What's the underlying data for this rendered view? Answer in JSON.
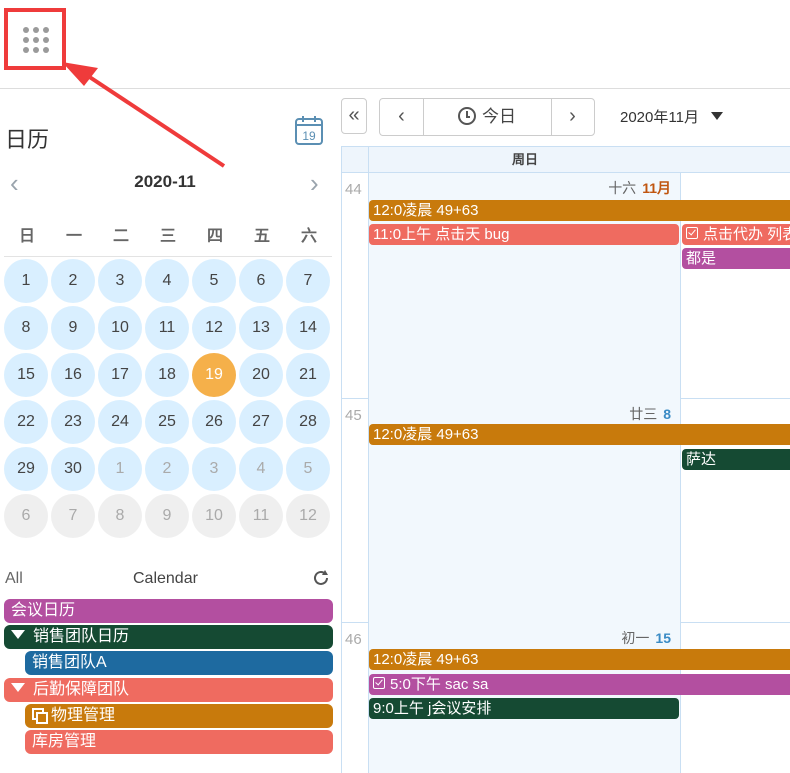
{
  "app": {
    "title": "日历"
  },
  "mini_calendar": {
    "month_label": "2020-11",
    "weekdays": [
      "日",
      "一",
      "二",
      "三",
      "四",
      "五",
      "六"
    ],
    "weeks": [
      [
        "1",
        "2",
        "3",
        "4",
        "5",
        "6",
        "7"
      ],
      [
        "8",
        "9",
        "10",
        "11",
        "12",
        "13",
        "14"
      ],
      [
        "15",
        "16",
        "17",
        "18",
        "19",
        "20",
        "21"
      ],
      [
        "22",
        "23",
        "24",
        "25",
        "26",
        "27",
        "28"
      ],
      [
        "29",
        "30",
        "1",
        "2",
        "3",
        "4",
        "5"
      ],
      [
        "6",
        "7",
        "8",
        "9",
        "10",
        "11",
        "12"
      ]
    ],
    "today": "19"
  },
  "calendar_list": {
    "all_label": "All",
    "header_label": "Calendar",
    "items": [
      {
        "label": "会议日历",
        "color": "#b34fa0"
      },
      {
        "label": "销售团队日历",
        "color": "#154a33"
      },
      {
        "label": "销售团队A",
        "color": "#1e6aa0"
      },
      {
        "label": "后勤保障团队",
        "color": "#ef6b60"
      },
      {
        "label": "物理管理",
        "color": "#c87a0c"
      },
      {
        "label": "库房管理",
        "color": "#ef6b60"
      }
    ]
  },
  "toolbar": {
    "collapse_label": "«",
    "prev_label": "‹",
    "today_label": "今日",
    "next_label": "›",
    "month_dropdown": "2020年11月"
  },
  "grid": {
    "header_sunday": "周日",
    "weeks": [
      {
        "number": "44",
        "lunar": "十六",
        "date": "11月",
        "events": [
          "12:0凌晨 49+63",
          "11:0上午 点击天 bug",
          "点击代办 列表",
          "都是"
        ]
      },
      {
        "number": "45",
        "lunar": "廿三",
        "date": "8",
        "events": [
          "12:0凌晨 49+63",
          "萨达"
        ]
      },
      {
        "number": "46",
        "lunar": "初一",
        "date": "15",
        "events": [
          "12:0凌晨 49+63",
          "5:0下午 sac sa",
          "9:0上午 j会议安排"
        ]
      }
    ]
  },
  "colors": {
    "orange": "#c87a0c",
    "salmon": "#ef6b60",
    "purple": "#b34fa0",
    "dark_green": "#154a33",
    "blue": "#1e6aa0",
    "today_highlight": "#f5b04a",
    "annotation_red": "#ef3b3b"
  }
}
